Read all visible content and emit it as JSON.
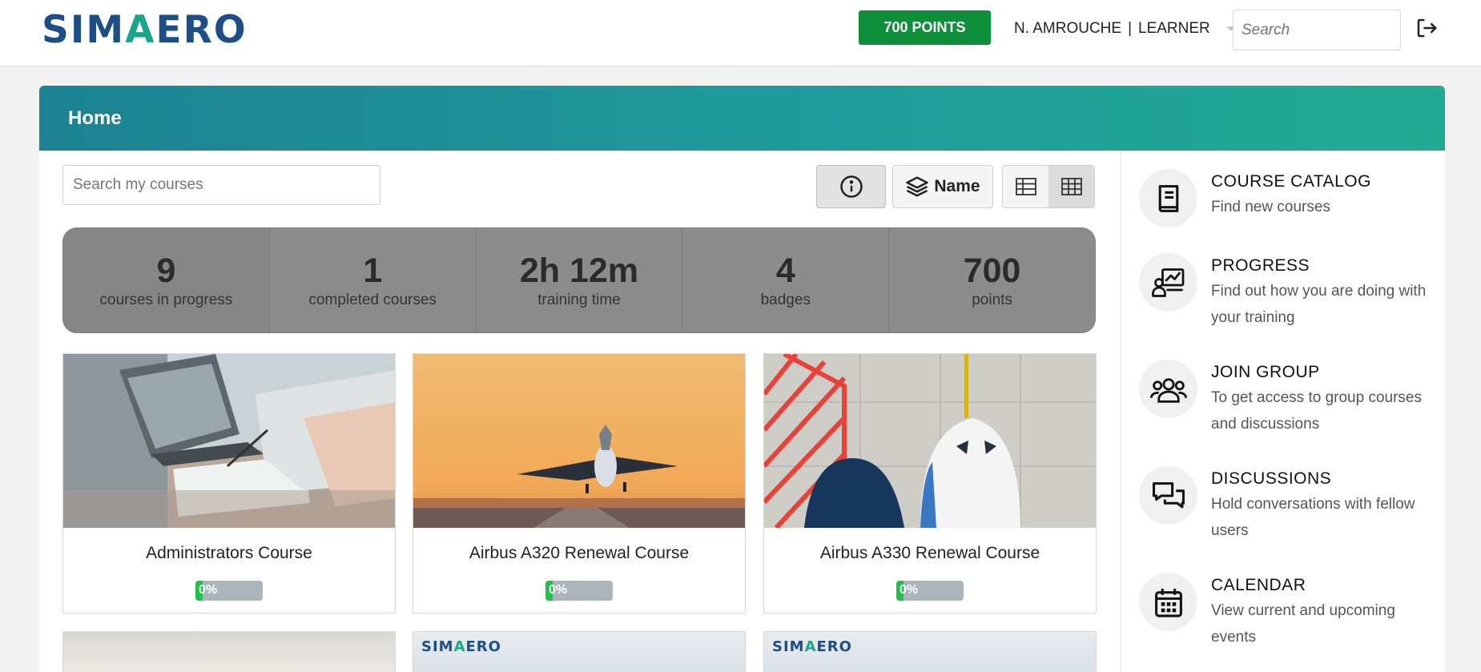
{
  "header": {
    "logo_text": "SIMAERO",
    "points_label": "700 POINTS",
    "user_name": "N. AMROUCHE",
    "user_separator": "|",
    "user_role": "LEARNER",
    "search_placeholder": "Search",
    "logout_icon": "logout-icon"
  },
  "panel": {
    "title": "Home",
    "search_placeholder": "Search my courses",
    "sort_label": "Name",
    "info_icon": "info-icon",
    "sort_icon": "layers-icon",
    "view_list_icon": "list-view-icon",
    "view_grid_icon": "grid-view-icon"
  },
  "stats": [
    {
      "value": "9",
      "label": "courses in progress"
    },
    {
      "value": "1",
      "label": "completed courses"
    },
    {
      "value": "2h 12m",
      "label": "training time"
    },
    {
      "value": "4",
      "label": "badges"
    },
    {
      "value": "700",
      "label": "points"
    }
  ],
  "courses": [
    {
      "title": "Administrators Course",
      "progress": 0,
      "progress_label": "0%"
    },
    {
      "title": "Airbus A320 Renewal Course",
      "progress": 0,
      "progress_label": "0%"
    },
    {
      "title": "Airbus A330 Renewal Course",
      "progress": 0,
      "progress_label": "0%"
    }
  ],
  "more_courses": [
    {
      "logo": ""
    },
    {
      "logo": "SIMAERO"
    },
    {
      "logo": "SIMAERO"
    }
  ],
  "sidebar": [
    {
      "title": "COURSE CATALOG",
      "desc": "Find new courses",
      "icon": "book-icon"
    },
    {
      "title": "PROGRESS",
      "desc": "Find out how you are doing with your training",
      "icon": "progress-chart-icon"
    },
    {
      "title": "JOIN GROUP",
      "desc": "To get access to group courses and discussions",
      "icon": "group-icon"
    },
    {
      "title": "DISCUSSIONS",
      "desc": "Hold conversations with fellow users",
      "icon": "chat-icon"
    },
    {
      "title": "CALENDAR",
      "desc": "View current and upcoming events",
      "icon": "calendar-icon"
    }
  ],
  "colors": {
    "accent_green": "#0e8f3a",
    "header_gradient_start": "#1c8292",
    "header_gradient_end": "#22ab93",
    "progress_fill": "#1fc24a"
  }
}
